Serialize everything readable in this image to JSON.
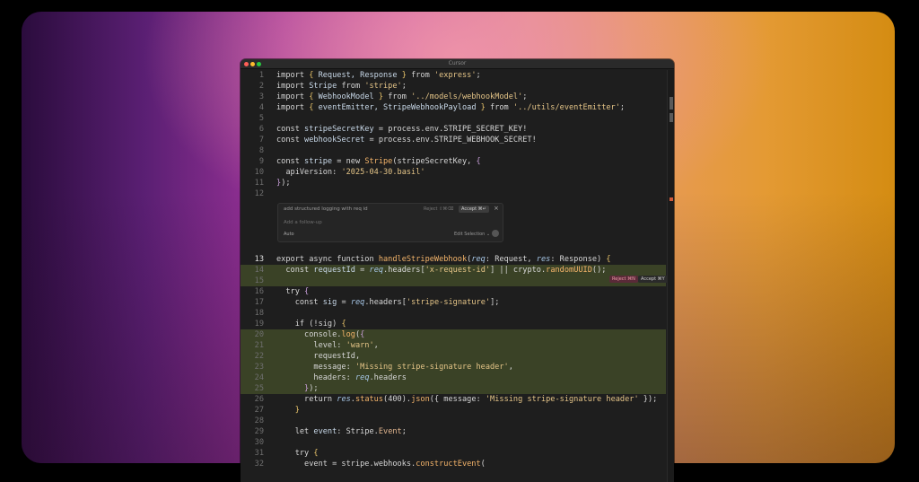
{
  "window": {
    "title": "Cursor"
  },
  "lines": [
    {
      "n": "1",
      "tokens": [
        [
          "k",
          "import "
        ],
        [
          "b",
          "{ "
        ],
        [
          "v",
          "Request, Response "
        ],
        [
          "b",
          "} "
        ],
        [
          "k",
          "from "
        ],
        [
          "s",
          "'express'"
        ],
        [
          "k",
          ";"
        ]
      ]
    },
    {
      "n": "2",
      "tokens": [
        [
          "k",
          "import "
        ],
        [
          "v",
          "Stripe "
        ],
        [
          "k",
          "from "
        ],
        [
          "s",
          "'stripe'"
        ],
        [
          "k",
          ";"
        ]
      ]
    },
    {
      "n": "3",
      "tokens": [
        [
          "k",
          "import "
        ],
        [
          "b",
          "{ "
        ],
        [
          "v",
          "WebhookModel "
        ],
        [
          "b",
          "} "
        ],
        [
          "k",
          "from "
        ],
        [
          "s",
          "'../models/webhookModel'"
        ],
        [
          "k",
          ";"
        ]
      ]
    },
    {
      "n": "4",
      "tokens": [
        [
          "k",
          "import "
        ],
        [
          "b",
          "{ "
        ],
        [
          "v",
          "eventEmitter, StripeWebhookPayload "
        ],
        [
          "b",
          "} "
        ],
        [
          "k",
          "from "
        ],
        [
          "s",
          "'../utils/eventEmitter'"
        ],
        [
          "k",
          ";"
        ]
      ]
    },
    {
      "n": "5",
      "tokens": []
    },
    {
      "n": "6",
      "tokens": [
        [
          "k",
          "const "
        ],
        [
          "v",
          "stripeSecretKey "
        ],
        [
          "k",
          "= process.env.STRIPE_SECRET_KEY!"
        ]
      ]
    },
    {
      "n": "7",
      "tokens": [
        [
          "k",
          "const "
        ],
        [
          "v",
          "webhookSecret "
        ],
        [
          "k",
          "= process.env.STRIPE_WEBHOOK_SECRET!"
        ]
      ]
    },
    {
      "n": "8",
      "tokens": []
    },
    {
      "n": "9",
      "tokens": [
        [
          "k",
          "const "
        ],
        [
          "v",
          "stripe "
        ],
        [
          "k",
          "= new "
        ],
        [
          "f",
          "Stripe"
        ],
        [
          "k",
          "(stripeSecretKey, "
        ],
        [
          "p",
          "{"
        ]
      ]
    },
    {
      "n": "10",
      "tokens": [
        [
          "k",
          "  apiVersion: "
        ],
        [
          "s",
          "'2025-04-30.basil'"
        ]
      ]
    },
    {
      "n": "11",
      "tokens": [
        [
          "p",
          "}"
        ],
        [
          "k",
          ");"
        ]
      ]
    },
    {
      "n": "12",
      "tokens": []
    },
    {
      "n": "13",
      "tokens": [
        [
          "k",
          "export async function "
        ],
        [
          "f",
          "handleStripeWebhook"
        ],
        [
          "k",
          "("
        ],
        [
          "i",
          "req"
        ],
        [
          "k",
          ": Request, "
        ],
        [
          "i",
          "res"
        ],
        [
          "k",
          ": Response) "
        ],
        [
          "b",
          "{"
        ]
      ],
      "active": true
    },
    {
      "n": "14",
      "tokens": [
        [
          "k",
          "  const "
        ],
        [
          "v",
          "requestId "
        ],
        [
          "k",
          "= "
        ],
        [
          "i",
          "req"
        ],
        [
          "k",
          ".headers["
        ],
        [
          "s",
          "'x-request-id'"
        ],
        [
          "k",
          "] || crypto."
        ],
        [
          "f",
          "randomUUID"
        ],
        [
          "k",
          "();"
        ]
      ],
      "hl": true
    },
    {
      "n": "15",
      "tokens": [],
      "hl": true
    },
    {
      "n": "16",
      "tokens": [
        [
          "k",
          "  try "
        ],
        [
          "p",
          "{"
        ]
      ]
    },
    {
      "n": "17",
      "tokens": [
        [
          "k",
          "    const "
        ],
        [
          "v",
          "sig "
        ],
        [
          "k",
          "= "
        ],
        [
          "i",
          "req"
        ],
        [
          "k",
          ".headers["
        ],
        [
          "s",
          "'stripe-signature'"
        ],
        [
          "k",
          "];"
        ]
      ]
    },
    {
      "n": "18",
      "tokens": []
    },
    {
      "n": "19",
      "tokens": [
        [
          "k",
          "    if (!sig) "
        ],
        [
          "b",
          "{"
        ]
      ]
    },
    {
      "n": "20",
      "tokens": [
        [
          "k",
          "      console."
        ],
        [
          "f",
          "log"
        ],
        [
          "k",
          "("
        ],
        [
          "p",
          "{"
        ]
      ],
      "hl": true
    },
    {
      "n": "21",
      "tokens": [
        [
          "k",
          "        level: "
        ],
        [
          "s",
          "'warn'"
        ],
        [
          "k",
          ","
        ]
      ],
      "hl": true
    },
    {
      "n": "22",
      "tokens": [
        [
          "k",
          "        requestId,"
        ]
      ],
      "hl": true
    },
    {
      "n": "23",
      "tokens": [
        [
          "k",
          "        message: "
        ],
        [
          "s",
          "'Missing stripe-signature header'"
        ],
        [
          "k",
          ","
        ]
      ],
      "hl": true
    },
    {
      "n": "24",
      "tokens": [
        [
          "k",
          "        headers: "
        ],
        [
          "i",
          "req"
        ],
        [
          "k",
          ".headers"
        ]
      ],
      "hl": true
    },
    {
      "n": "25",
      "tokens": [
        [
          "p",
          "      }"
        ],
        [
          "k",
          ");"
        ]
      ],
      "hl": true
    },
    {
      "n": "26",
      "tokens": [
        [
          "k",
          "      return "
        ],
        [
          "i",
          "res"
        ],
        [
          "k",
          "."
        ],
        [
          "f",
          "status"
        ],
        [
          "k",
          "(400)."
        ],
        [
          "f",
          "json"
        ],
        [
          "k",
          "({ message: "
        ],
        [
          "s",
          "'Missing stripe-signature header'"
        ],
        [
          "k",
          " });"
        ]
      ]
    },
    {
      "n": "27",
      "tokens": [
        [
          "b",
          "    }"
        ]
      ]
    },
    {
      "n": "28",
      "tokens": []
    },
    {
      "n": "29",
      "tokens": [
        [
          "k",
          "    let "
        ],
        [
          "v",
          "event"
        ],
        [
          "k",
          ": Stripe."
        ],
        [
          "t",
          "Event"
        ],
        [
          "k",
          ";"
        ]
      ]
    },
    {
      "n": "30",
      "tokens": []
    },
    {
      "n": "31",
      "tokens": [
        [
          "k",
          "    try "
        ],
        [
          "b",
          "{"
        ]
      ]
    },
    {
      "n": "32",
      "tokens": [
        [
          "k",
          "      event = stripe.webhooks."
        ],
        [
          "f",
          "constructEvent"
        ],
        [
          "k",
          "("
        ]
      ]
    }
  ],
  "prompt": {
    "query": "add structured logging with req id",
    "reject": "Reject ⇧⌘⌫",
    "accept": "Accept ⌘↵",
    "followup_placeholder": "Add a follow-up",
    "mode": "Auto",
    "edit": "Edit Selection ⌄"
  },
  "diff": {
    "reject": "Reject ⌘N",
    "accept": "Accept ⌘Y"
  }
}
